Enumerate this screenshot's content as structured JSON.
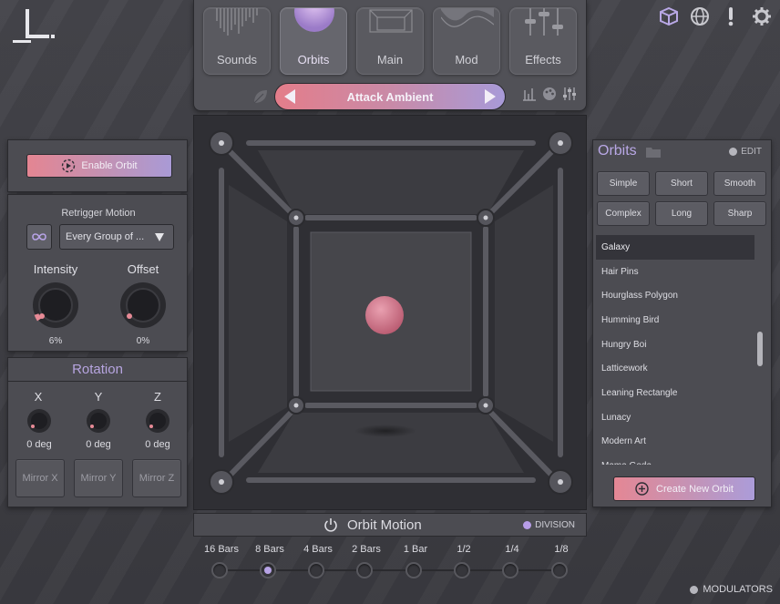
{
  "logo": {
    "text": "L."
  },
  "top_icons": [
    "cube-icon",
    "globe-icon",
    "exclamation-icon",
    "gear-icon"
  ],
  "tabs": [
    {
      "label": "Sounds",
      "icon": "waveform-art"
    },
    {
      "label": "Orbits",
      "icon": "orb-art",
      "active": true
    },
    {
      "label": "Main",
      "icon": "grid-art"
    },
    {
      "label": "Mod",
      "icon": "wave-art"
    },
    {
      "label": "Effects",
      "icon": "sliders-art"
    }
  ],
  "preset": {
    "name": "Attack Ambient"
  },
  "left": {
    "enable_label": "Enable Orbit",
    "retrigger_label": "Retrigger Motion",
    "retrigger_value": "Every Group of ...",
    "intensity_label": "Intensity",
    "intensity_value": "6%",
    "offset_label": "Offset",
    "offset_value": "0%",
    "rotation_title": "Rotation",
    "axes": [
      {
        "label": "X",
        "value": "0 deg",
        "mirror": "Mirror X"
      },
      {
        "label": "Y",
        "value": "0 deg",
        "mirror": "Mirror Y"
      },
      {
        "label": "Z",
        "value": "0 deg",
        "mirror": "Mirror Z"
      }
    ]
  },
  "right": {
    "title": "Orbits",
    "edit_label": "EDIT",
    "filters": [
      "Simple",
      "Short",
      "Smooth",
      "Complex",
      "Long",
      "Sharp"
    ],
    "orbits": [
      "Galaxy",
      "Hair Pins",
      "Hourglass Polygon",
      "Humming Bird",
      "Hungry Boi",
      "Latticework",
      "Leaning Rectangle",
      "Lunacy",
      "Modern Art",
      "Mama Goda"
    ],
    "selected": "Galaxy",
    "create_label": "Create New Orbit"
  },
  "motion": {
    "title": "Orbit Motion",
    "division_label": "DIVISION",
    "divisions": [
      "16 Bars",
      "8 Bars",
      "4 Bars",
      "2 Bars",
      "1 Bar",
      "1/2",
      "1/4",
      "1/8"
    ],
    "selected_division": "8 Bars"
  },
  "modulators_label": "MODULATORS",
  "colors": {
    "accent_pink": "#e47d8a",
    "accent_purple": "#a89ad8",
    "orb": "#d47588"
  }
}
